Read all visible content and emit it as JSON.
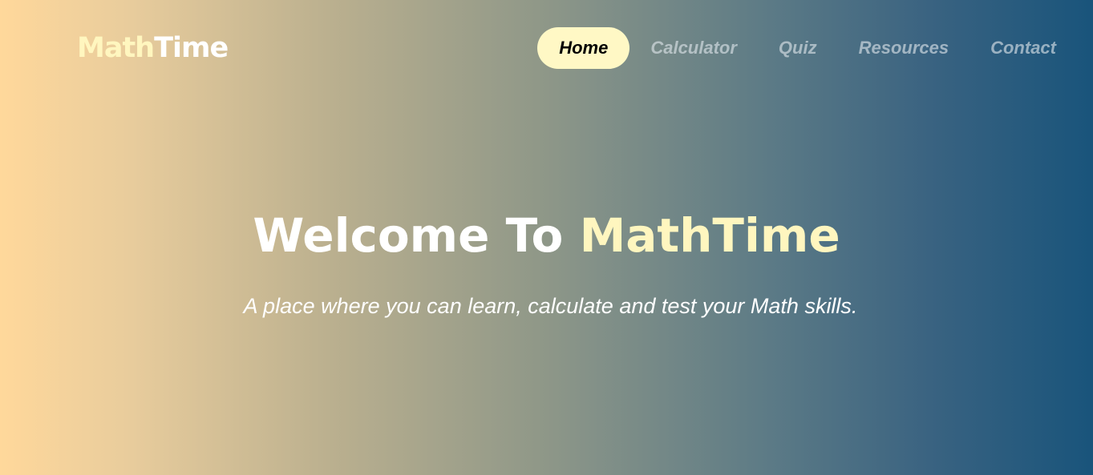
{
  "brand": {
    "part_a": "Math",
    "part_b": "Time"
  },
  "nav": {
    "items": [
      {
        "label": "Home",
        "active": true
      },
      {
        "label": "Calculator",
        "active": false
      },
      {
        "label": "Quiz",
        "active": false
      },
      {
        "label": "Resources",
        "active": false
      },
      {
        "label": "Contact",
        "active": false
      }
    ]
  },
  "hero": {
    "title_prefix": "Welcome To",
    "title_highlight": "MathTime",
    "subtitle": "A place where you can learn, calculate and test your Math skills."
  },
  "colors": {
    "gradient_start": "#ffd89b",
    "gradient_end": "#19547b",
    "accent": "#fff6bf",
    "active_pill": "#fff8c5",
    "text": "#ffffff"
  }
}
